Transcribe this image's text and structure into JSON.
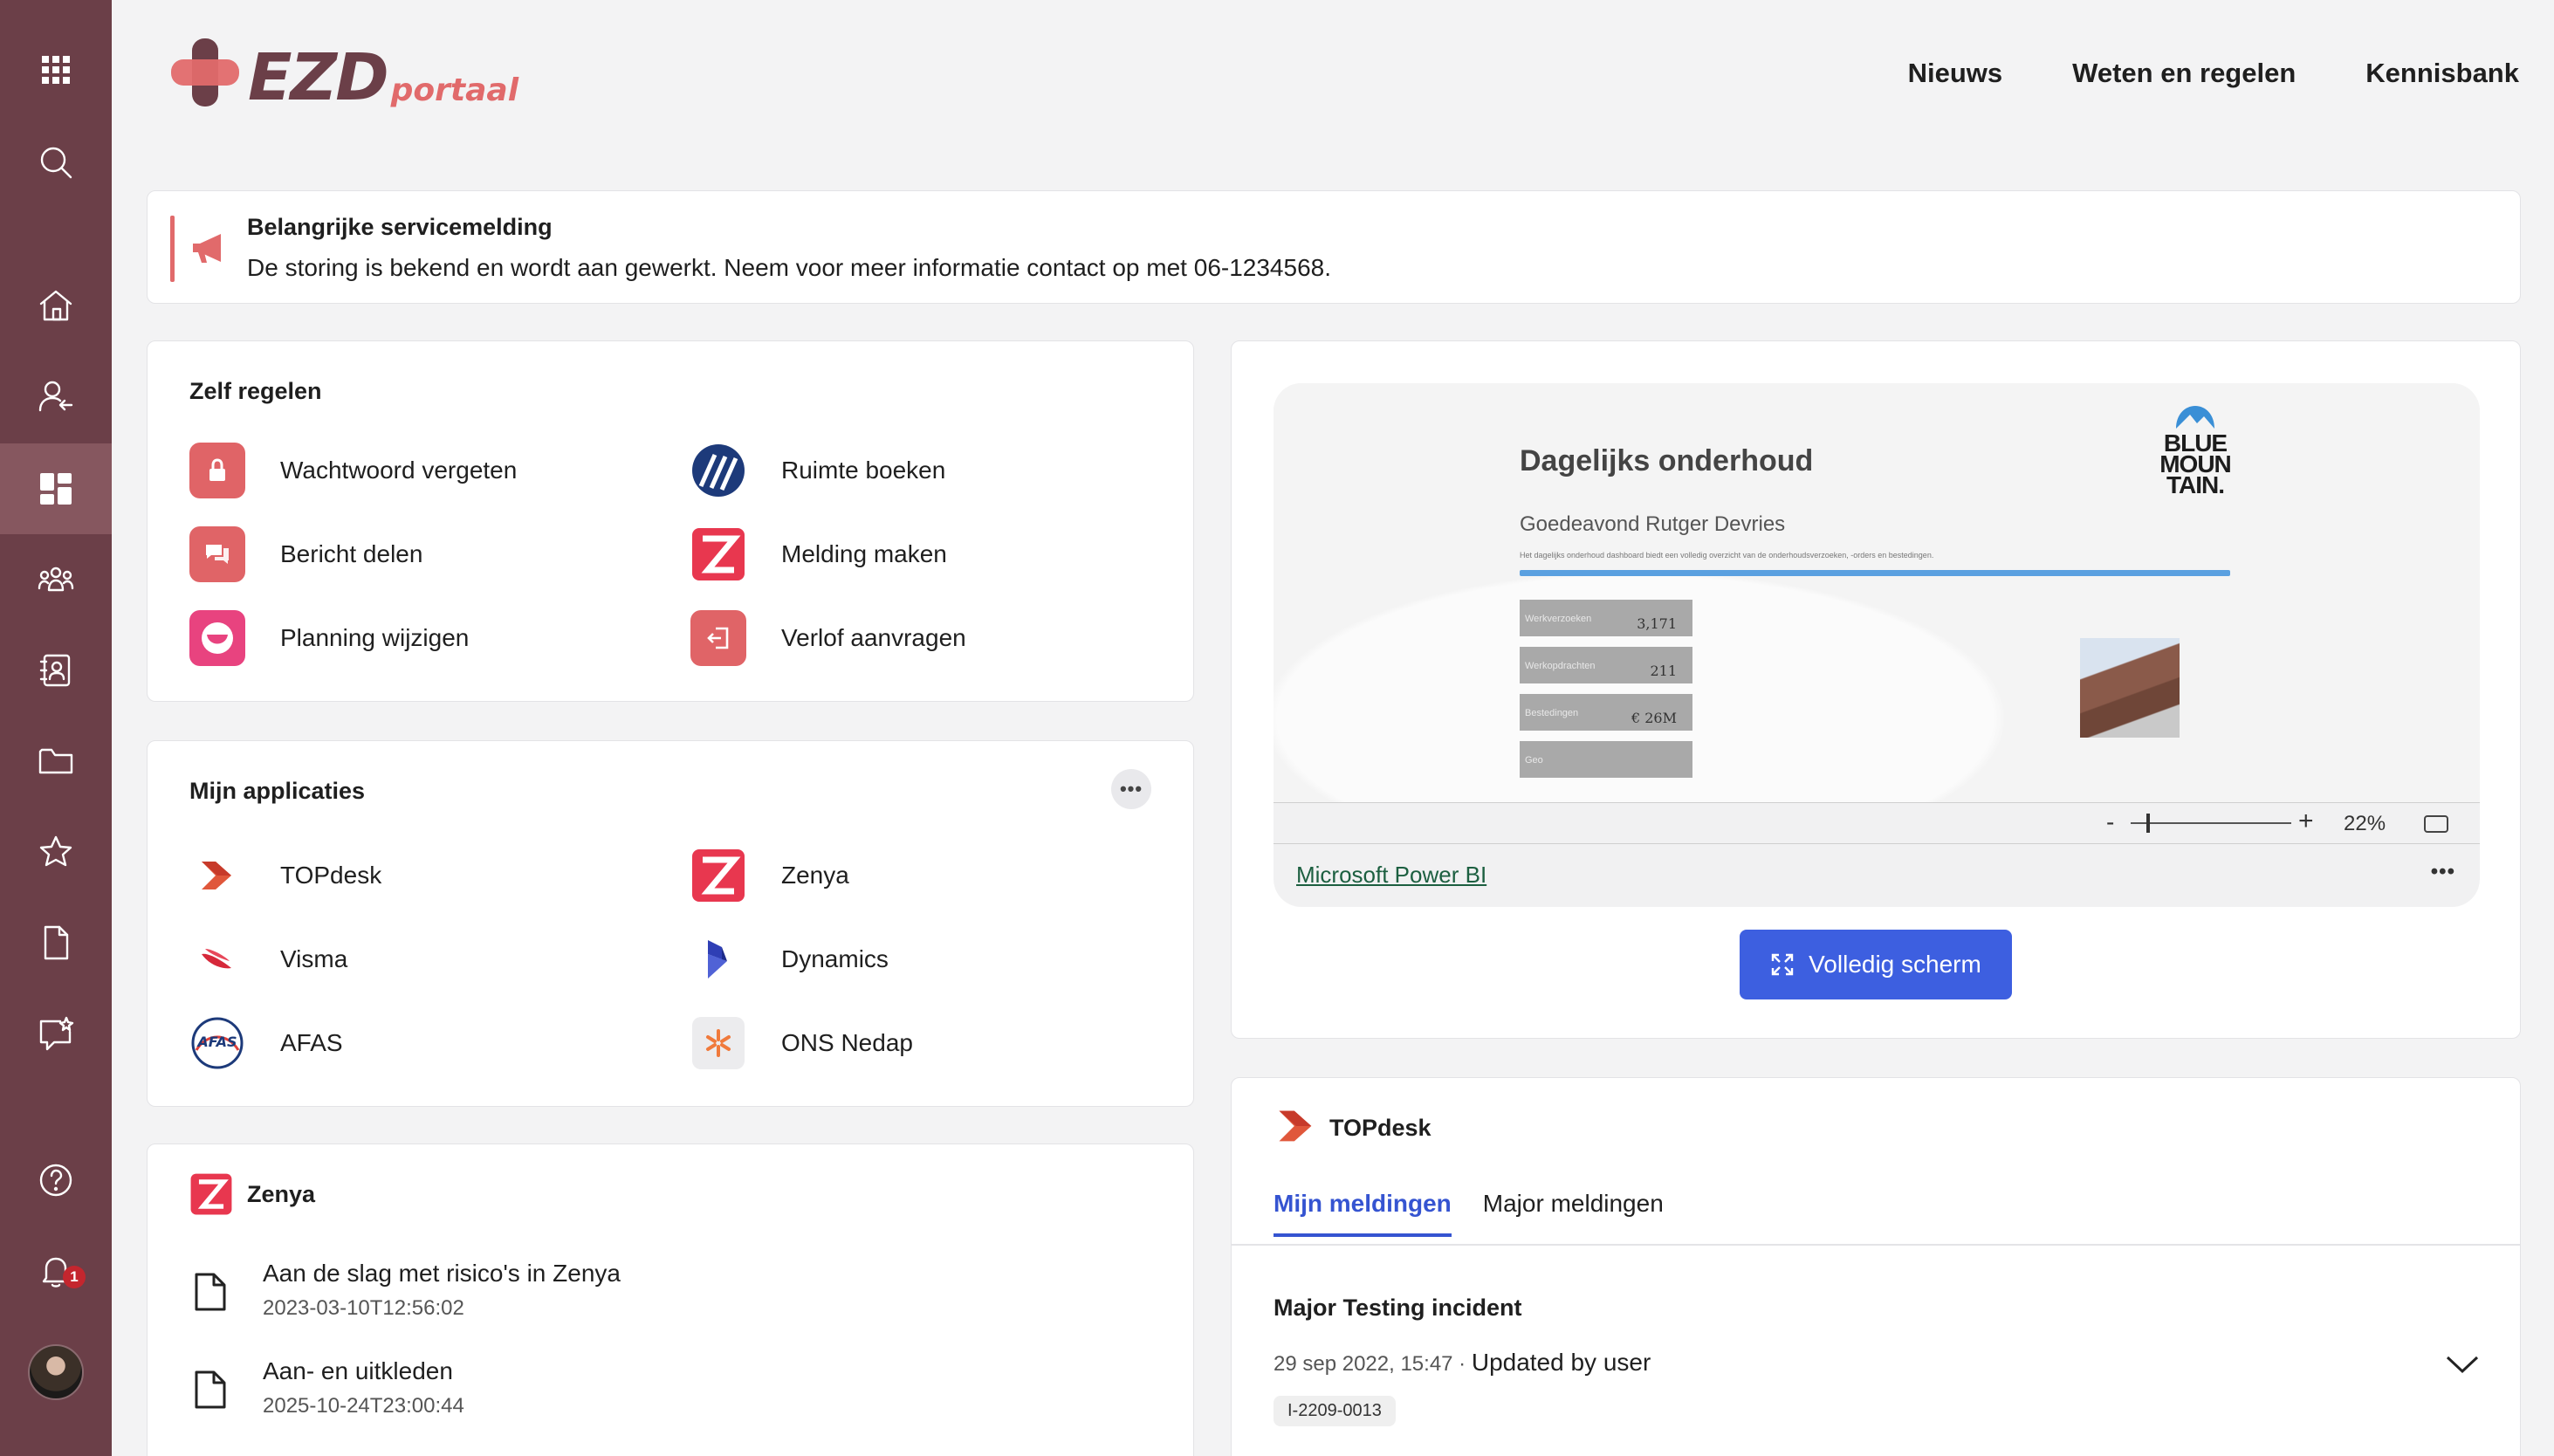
{
  "brand": {
    "ezd": "EZD",
    "portaal": "portaal"
  },
  "nav": [
    "Nieuws",
    "Weten en regelen",
    "Kennisbank"
  ],
  "notification_count": "1",
  "notice": {
    "title": "Belangrijke servicemelding",
    "message": "De storing is bekend en wordt aan gewerkt. Neem voor meer informatie contact op met 06-1234568."
  },
  "zelf_regelen": {
    "title": "Zelf regelen",
    "items": [
      "Wachtwoord vergeten",
      "Ruimte boeken",
      "Bericht delen",
      "Melding maken",
      "Planning wijzigen",
      "Verlof aanvragen"
    ]
  },
  "applicaties": {
    "title": "Mijn applicaties",
    "more": "•••",
    "items": [
      "TOPdesk",
      "Zenya",
      "Visma",
      "Dynamics",
      "AFAS",
      "ONS Nedap"
    ]
  },
  "zenya": {
    "title": "Zenya",
    "docs": [
      {
        "title": "Aan de slag met risico's in Zenya",
        "date": "2023-03-10T12:56:02"
      },
      {
        "title": "Aan- en uitkleden",
        "date": "2025-10-24T23:00:44"
      }
    ]
  },
  "powerbi": {
    "report_title": "Dagelijks onderhoud",
    "greeting": "Goedeavond Rutger Devries",
    "subtitle": "Het dagelijks onderhoud dashboard biedt een volledig overzicht van de onderhoudsverzoeken, -orders en bestedingen.",
    "logo_text": [
      "BLUE",
      "MOUN",
      "TAIN."
    ],
    "kpis": [
      {
        "label": "Werkverzoeken",
        "value": "3,171"
      },
      {
        "label": "Werkopdrachten",
        "value": "211"
      },
      {
        "label": "Bestedingen",
        "value": "€ 26M"
      },
      {
        "label": "Geo",
        "value": ""
      }
    ],
    "zoom_minus": "-",
    "zoom_plus": "+",
    "zoom": "22%",
    "link": "Microsoft Power BI",
    "dots": "•••",
    "fullscreen": "Volledig scherm"
  },
  "topdesk": {
    "title": "TOPdesk",
    "tabs": [
      "Mijn meldingen",
      "Major meldingen"
    ],
    "incident": {
      "title": "Major Testing incident",
      "date": "29 sep 2022, 15:47",
      "separator": " · ",
      "updated_by": "Updated by user",
      "id": "I-2209-0013"
    }
  }
}
